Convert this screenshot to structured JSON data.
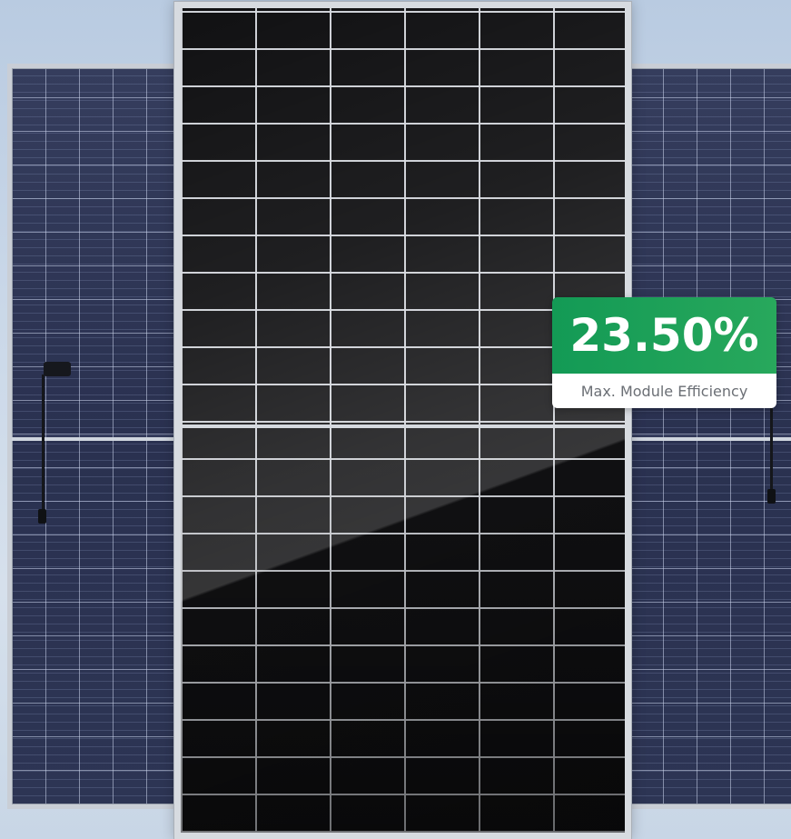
{
  "badge": {
    "value": "23.50%",
    "label": "Max. Module Efficiency"
  },
  "colors": {
    "badge_green": "#1e9e58",
    "front_panel": "#111113",
    "back_panel": "#2b3350",
    "frame": "#d7dbe0"
  }
}
